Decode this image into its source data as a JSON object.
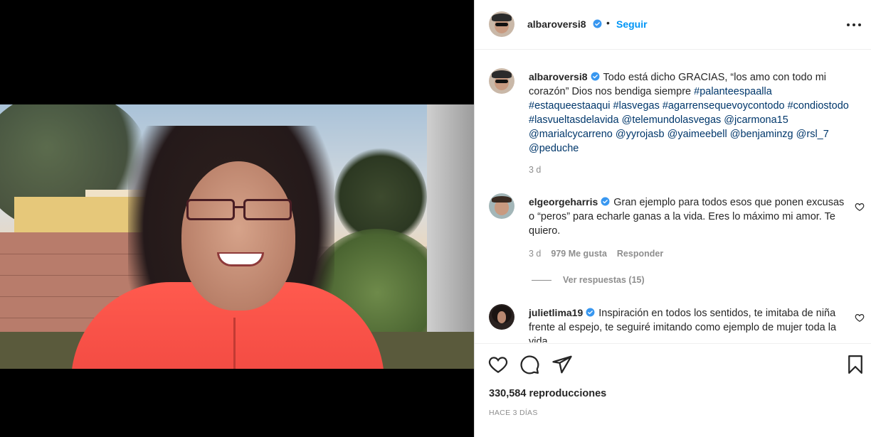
{
  "post": {
    "author": "albaroversi8",
    "separator": "•",
    "follow_label": "Seguir"
  },
  "caption": {
    "author": "albaroversi8",
    "text": "Todo está dicho GRACIAS, “los amo con todo mi corazón” Dios nos bendiga siempre ",
    "tags": [
      "#palanteespaalla",
      "#estaqueestaaqui",
      "#lasvegas",
      "#agarrensequevoycontodo",
      "#condiostodo",
      "#lasvueltasdelavida",
      "@telemundolasvegas",
      "@jcarmona15",
      "@marialcycarreno",
      "@yyrojasb",
      "@yaimeebell",
      "@benjaminzg",
      "@rsl_7",
      "@peduche"
    ],
    "time": "3 d"
  },
  "comments": [
    {
      "author": "elgeorgeharris",
      "text": "Gran ejemplo para todos esos que ponen excusas o “peros” para echarle ganas a la vida. Eres lo máximo mi amor. Te quiero.",
      "time": "3 d",
      "likes": "979 Me gusta",
      "reply_label": "Responder",
      "view_replies": "Ver respuestas (15)"
    },
    {
      "author": "julietlima19",
      "text": "Inspiración en todos los sentidos, te imitaba de niña frente al espejo, te seguiré imitando como ejemplo de mujer toda la vida"
    }
  ],
  "footer": {
    "views": "330,584 reproducciones",
    "posted": "HACE 3 DÍAS"
  },
  "icons": {
    "like": "heart-icon",
    "comment": "comment-icon",
    "share": "share-icon",
    "save": "bookmark-icon",
    "more": "more-options-icon",
    "verified": "verified-badge-icon"
  },
  "colors": {
    "accent": "#0095f6",
    "verified": "#3897f0",
    "tag": "#00376b",
    "muted": "#8e8e8e"
  }
}
